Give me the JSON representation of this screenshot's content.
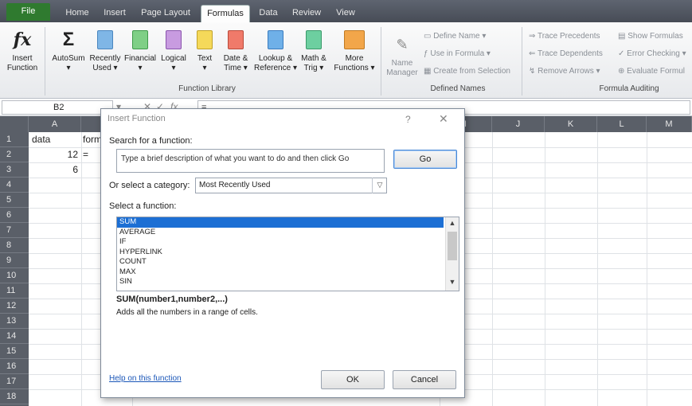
{
  "ribbon_tabs": [
    "File",
    "Home",
    "Insert",
    "Page Layout",
    "Formulas",
    "Data",
    "Review",
    "View"
  ],
  "function_library": {
    "insert_function": {
      "line1": "Insert",
      "line2": "Function"
    },
    "autosum": {
      "line1": "AutoSum",
      "line2": "▾"
    },
    "recently_used": {
      "line1": "Recently",
      "line2": "Used ▾"
    },
    "financial": {
      "line1": "Financial",
      "line2": "▾"
    },
    "logical": {
      "line1": "Logical",
      "line2": "▾"
    },
    "text": {
      "line1": "Text",
      "line2": "▾"
    },
    "date_time": {
      "line1": "Date &",
      "line2": "Time ▾"
    },
    "lookup": {
      "line1": "Lookup &",
      "line2": "Reference ▾"
    },
    "math_trig": {
      "line1": "Math &",
      "line2": "Trig ▾"
    },
    "more": {
      "line1": "More",
      "line2": "Functions ▾"
    },
    "group_label": "Function Library"
  },
  "defined_names": {
    "name_manager": {
      "line1": "Name",
      "line2": "Manager"
    },
    "define_name": "Define Name ▾",
    "use_in_formula": "Use in Formula ▾",
    "create_from_selection": "Create from Selection",
    "group_label": "Defined Names"
  },
  "formula_auditing": {
    "trace_precedents": "Trace Precedents",
    "trace_dependents": "Trace Dependents",
    "remove_arrows": "Remove Arrows ▾",
    "show_formulas": "Show Formulas",
    "error_checking": "Error Checking ▾",
    "evaluate_formula": "Evaluate Formul",
    "group_label": "Formula Auditing"
  },
  "formula_bar": {
    "name_box": "B2",
    "content": "="
  },
  "columns": [
    "A",
    "",
    "",
    "",
    "",
    "",
    "",
    "",
    "I",
    "J",
    "K",
    "L",
    "M"
  ],
  "rows": [
    "1",
    "2",
    "3",
    "4",
    "5",
    "6",
    "7",
    "8",
    "9",
    "10",
    "11",
    "12",
    "13",
    "14",
    "15",
    "16",
    "17",
    "18"
  ],
  "cells": {
    "a1": "data",
    "b1": "form",
    "a2": "12",
    "b2": "=",
    "a3": "6"
  },
  "dialog": {
    "title": "Insert Function",
    "help_symbol": "?",
    "close_symbol": "✕",
    "search_label": "Search for a function:",
    "search_value": "Type a brief description of what you want to do and then click Go",
    "go_label": "Go",
    "category_label": "Or select a category:",
    "category_value": "Most Recently Used",
    "category_arrow": "▽",
    "select_label": "Select a function:",
    "functions": [
      "SUM",
      "AVERAGE",
      "IF",
      "HYPERLINK",
      "COUNT",
      "MAX",
      "SIN"
    ],
    "scroll_up": "▲",
    "scroll_down": "▼",
    "signature": "SUM(number1,number2,...)",
    "description": "Adds all the numbers in a range of cells.",
    "help_link": "Help on this function",
    "ok_label": "OK",
    "cancel_label": "Cancel"
  },
  "colors": {
    "accent_blue": "#1c6fd4",
    "file_tab": "#2f7a2f",
    "header_gray": "#5a5f68"
  }
}
